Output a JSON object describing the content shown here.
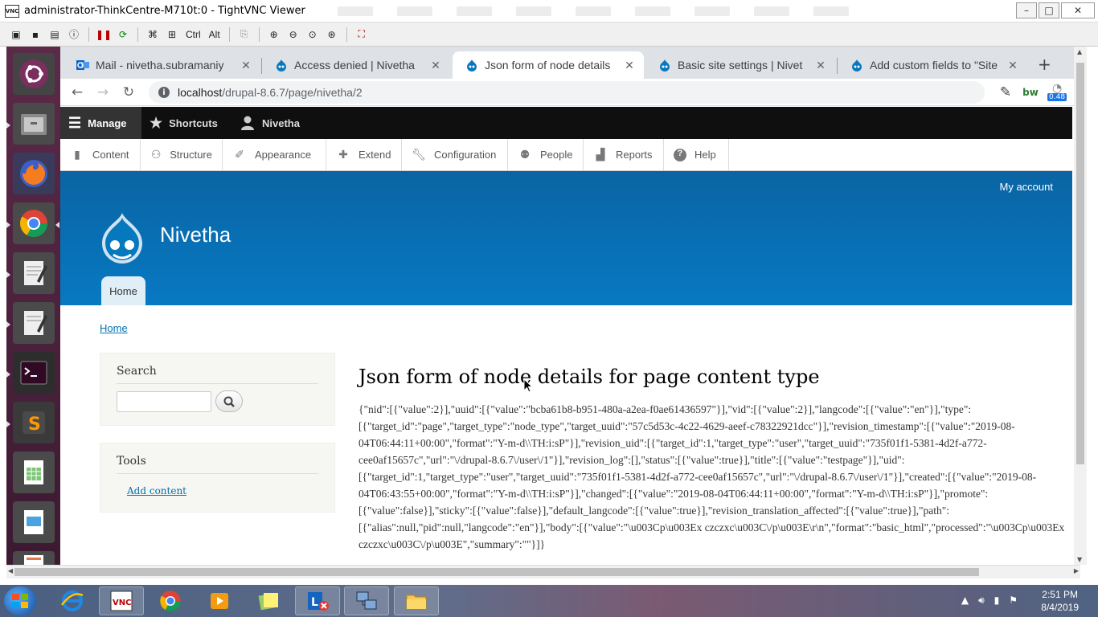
{
  "vnc": {
    "title": "administrator-ThinkCentre-M710t:0 - TightVNC Viewer",
    "logo": "VNC",
    "minimize": "–",
    "maximize": "□",
    "close": "✕",
    "toolbar_ctrl": "Ctrl",
    "toolbar_alt": "Alt"
  },
  "browser": {
    "tabs": [
      {
        "label": "Mail - nivetha.subramaniy",
        "icon": "outlook-icon",
        "active": false
      },
      {
        "label": "Access denied | Nivetha",
        "icon": "drupal-icon",
        "active": false
      },
      {
        "label": "Json form of node details",
        "icon": "drupal-icon",
        "active": true
      },
      {
        "label": "Basic site settings | Nivet",
        "icon": "drupal-icon",
        "active": false
      },
      {
        "label": "Add custom fields to \"Site",
        "icon": "drupal-icon",
        "active": false
      }
    ],
    "new_tab": "+",
    "url_host": "localhost",
    "url_path": "/drupal-8.6.7/page/nivetha/2",
    "extension_badge": "0.48",
    "bw_label": "bw"
  },
  "drupal_toolbar": {
    "manage": "Manage",
    "shortcuts": "Shortcuts",
    "user": "Nivetha",
    "tray": [
      "Content",
      "Structure",
      "Appearance",
      "Extend",
      "Configuration",
      "People",
      "Reports",
      "Help"
    ]
  },
  "header": {
    "my_account": "My account",
    "site_name": "Nivetha",
    "home_tab": "Home"
  },
  "breadcrumb": "Home",
  "sidebar": {
    "search_title": "Search",
    "tools_title": "Tools",
    "add_content": "Add content"
  },
  "main": {
    "title": "Json form of node details for page content type",
    "json_lines": [
      "{\"nid\":[{\"value\":2}],\"uuid\":[{\"value\":\"bcba61b8-b951-480a-a2ea-f0ae61436597\"}],\"vid\":[{\"value\":2}],\"langcode\":[{\"value\":\"en\"}],\"type\":",
      "[{\"target_id\":\"page\",\"target_type\":\"node_type\",\"target_uuid\":\"57c5d53c-4c22-4629-aeef-c78322921dcc\"}],\"revision_timestamp\":[{\"value\":\"2019-08-",
      "04T06:44:11+00:00\",\"format\":\"Y-m-d\\\\TH:i:sP\"}],\"revision_uid\":[{\"target_id\":1,\"target_type\":\"user\",\"target_uuid\":\"735f01f1-5381-4d2f-a772-",
      "cee0af15657c\",\"url\":\"\\/drupal-8.6.7\\/user\\/1\"}],\"revision_log\":[],\"status\":[{\"value\":true}],\"title\":[{\"value\":\"testpage\"}],\"uid\":",
      "[{\"target_id\":1,\"target_type\":\"user\",\"target_uuid\":\"735f01f1-5381-4d2f-a772-cee0af15657c\",\"url\":\"\\/drupal-8.6.7\\/user\\/1\"}],\"created\":[{\"value\":\"2019-08-",
      "04T06:43:55+00:00\",\"format\":\"Y-m-d\\\\TH:i:sP\"}],\"changed\":[{\"value\":\"2019-08-04T06:44:11+00:00\",\"format\":\"Y-m-d\\\\TH:i:sP\"}],\"promote\":",
      "[{\"value\":false}],\"sticky\":[{\"value\":false}],\"default_langcode\":[{\"value\":true}],\"revision_translation_affected\":[{\"value\":true}],\"path\":",
      "[{\"alias\":null,\"pid\":null,\"langcode\":\"en\"}],\"body\":[{\"value\":\"\\u003Cp\\u003Ex czczxc\\u003C\\/p\\u003E\\r\\n\",\"format\":\"basic_html\",\"processed\":\"\\u003Cp\\u003Ex",
      "czczxc\\u003C\\/p\\u003E\",\"summary\":\"\"}]}"
    ]
  },
  "taskbar": {
    "time": "2:51 PM",
    "date": "8/4/2019"
  }
}
